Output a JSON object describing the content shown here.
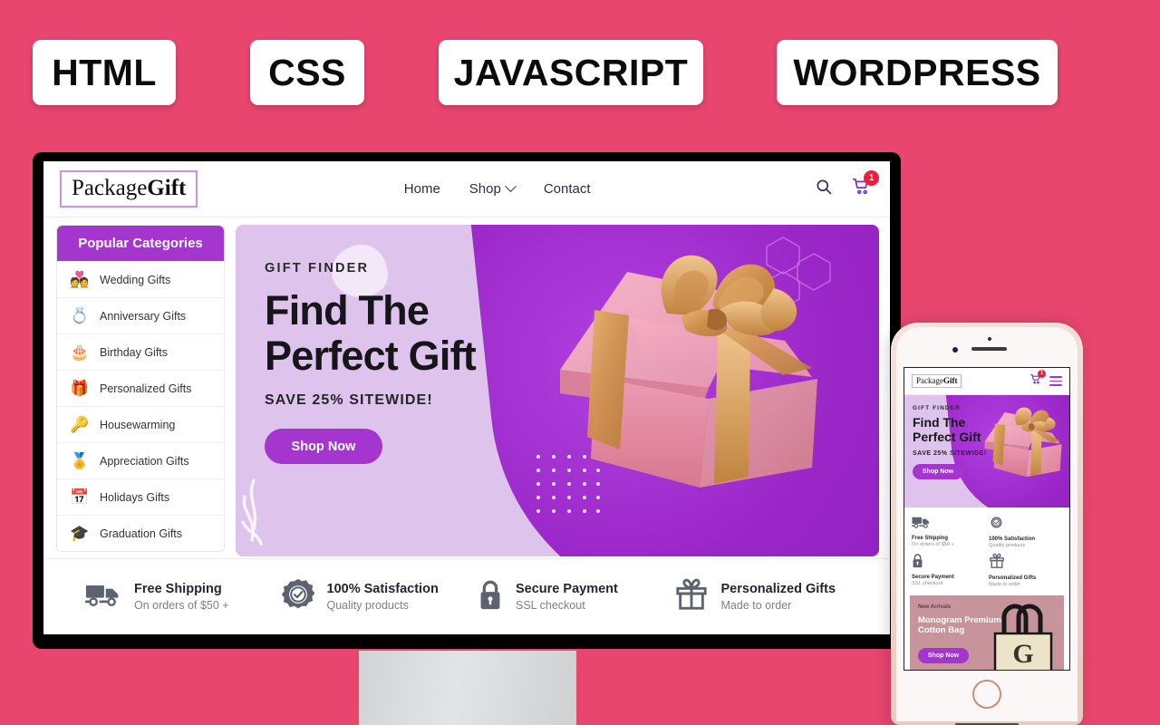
{
  "theme": {
    "background_pink": "#E8466F",
    "accent_purple": "#A435CE",
    "hero_lavender": "#DEC3EC",
    "badge_red": "#EF1C3A"
  },
  "tech_tags": [
    {
      "label": "HTML"
    },
    {
      "label": "CSS"
    },
    {
      "label": "JAVASCRIPT"
    },
    {
      "label": "WORDPRESS"
    }
  ],
  "desktop": {
    "header": {
      "logo": {
        "part1": "Package",
        "part2": "Gift"
      },
      "nav": [
        {
          "label": "Home",
          "has_caret": false
        },
        {
          "label": "Shop",
          "has_caret": true
        },
        {
          "label": "Contact",
          "has_caret": false
        }
      ],
      "search_icon": "search-icon",
      "cart_icon": "cart-icon",
      "cart_count": "1"
    },
    "sidebar": {
      "title": "Popular Categories",
      "items": [
        {
          "label": "Wedding Gifts",
          "icon": "wedding-couple-icon"
        },
        {
          "label": "Anniversary Gifts",
          "icon": "rings-icon"
        },
        {
          "label": "Birthday Gifts",
          "icon": "birthday-cake-icon"
        },
        {
          "label": "Personalized Gifts",
          "icon": "gift-box-icon"
        },
        {
          "label": "Housewarming",
          "icon": "key-icon"
        },
        {
          "label": "Appreciation Gifts",
          "icon": "award-ribbon-icon"
        },
        {
          "label": "Holidays Gifts",
          "icon": "calendar-icon"
        },
        {
          "label": "Graduation Gifts",
          "icon": "graduation-cap-icon"
        }
      ]
    },
    "hero": {
      "eyebrow": "GIFT FINDER",
      "heading_line1": "Find The",
      "heading_line2": "Perfect Gift",
      "subheading": "SAVE 25% SITEWIDE!",
      "cta": "Shop Now",
      "image": "pink-gift-box-with-gold-ribbon"
    },
    "features": [
      {
        "icon": "delivery-truck-icon",
        "title": "Free Shipping",
        "subtitle": "On orders of $50 +"
      },
      {
        "icon": "check-seal-icon",
        "title": "100% Satisfaction",
        "subtitle": "Quality products"
      },
      {
        "icon": "padlock-icon",
        "title": "Secure Payment",
        "subtitle": "SSL checkout"
      },
      {
        "icon": "gift-icon",
        "title": "Personalized Gifts",
        "subtitle": "Made to order"
      }
    ]
  },
  "mobile": {
    "header": {
      "logo": {
        "part1": "Package",
        "part2": "Gift"
      },
      "cart_count": "1",
      "menu_icon": "hamburger-menu-icon"
    },
    "hero": {
      "eyebrow": "GIFT FINDER",
      "heading_line1": "Find The",
      "heading_line2": "Perfect Gift",
      "subheading": "SAVE 25% SITEWIDE!",
      "cta": "Shop Now"
    },
    "features": [
      {
        "icon": "delivery-truck-icon",
        "title": "Free Shipping",
        "subtitle": "On orders of $50 +"
      },
      {
        "icon": "check-seal-icon",
        "title": "100% Satisfaction",
        "subtitle": "Quality products"
      },
      {
        "icon": "padlock-icon",
        "title": "Secure Payment",
        "subtitle": "SSL checkout"
      },
      {
        "icon": "gift-icon",
        "title": "Personalized Gifts",
        "subtitle": "Made to order"
      }
    ],
    "promo": {
      "tag": "New Arrivals",
      "title": "Monogram Premium Cotton Bag",
      "cta": "Shop Now",
      "image": "monogram-tote-bag-letter-G",
      "monogram_letter": "G"
    }
  }
}
